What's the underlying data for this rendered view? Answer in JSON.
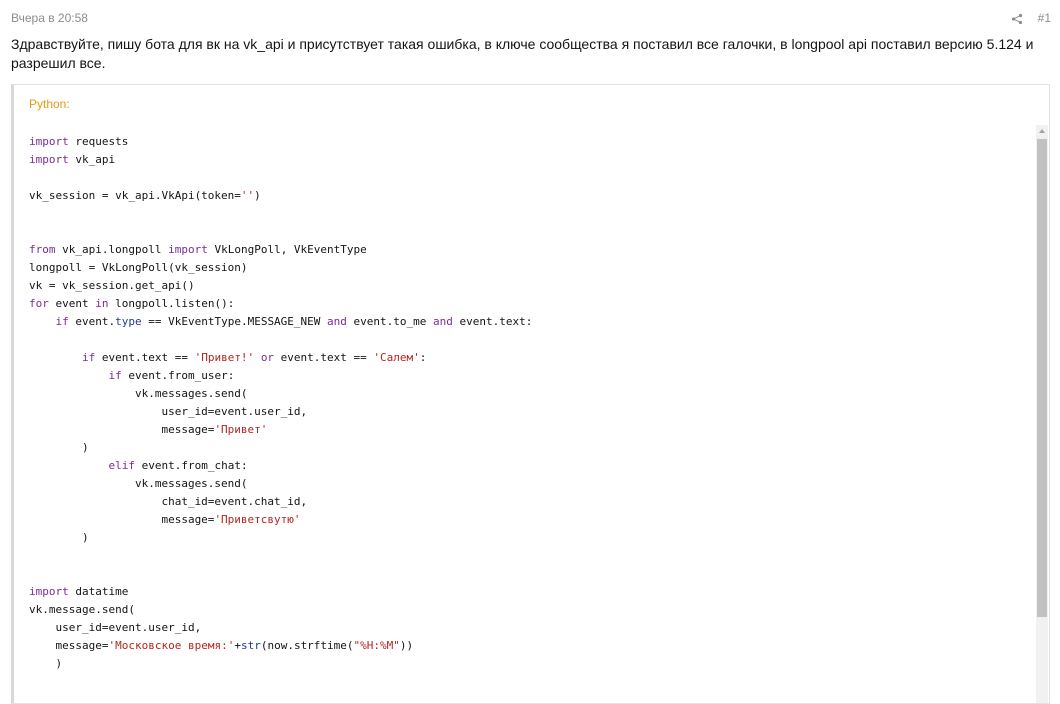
{
  "post": {
    "timestamp": "Вчера в 20:58",
    "number": "#1",
    "share_icon": "share-icon",
    "text": "Здравствуйте, пишу бота для вк на vk_api и присутствует такая ошибка, в ключе сообщества я поставил все галочки, в longpool api поставил версию 5.124 и разрешил все."
  },
  "code": {
    "language_label": "Python:",
    "lines": [
      "import requests",
      "import vk_api",
      "",
      "vk_session = vk_api.VkApi(token='')",
      "",
      "",
      "from vk_api.longpoll import VkLongPoll, VkEventType",
      "longpoll = VkLongPoll(vk_session)",
      "vk = vk_session.get_api()",
      "for event in longpoll.listen():",
      "    if event.type == VkEventType.MESSAGE_NEW and event.to_me and event.text:",
      "",
      "        if event.text == 'Привет!' or event.text == 'Салем':",
      "            if event.from_user:",
      "                vk.messages.send(",
      "                    user_id=event.user_id,",
      "                    message='Привет'",
      "        )",
      "            elif event.from_chat:",
      "                vk.messages.send(",
      "                    chat_id=event.chat_id,",
      "                    message='Приветсвутю'",
      "        )",
      "",
      "",
      "import datatime",
      "vk.message.send(",
      "    user_id=event.user_id,",
      "    message='Московское время:'+str(now.strftime(\"%H:%M\"))",
      "    )"
    ]
  },
  "colors": {
    "keyword": "#7a2b9c",
    "string": "#b3261e",
    "builtin": "#1f3a93",
    "language_label": "#e39b13"
  }
}
